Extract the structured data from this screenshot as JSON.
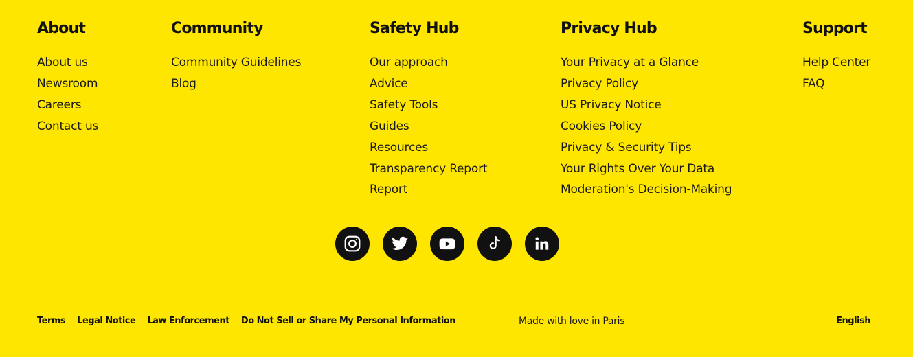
{
  "colors": {
    "background": "#FFE600",
    "text": "#1a1a1a",
    "icon_bg": "#111111",
    "icon_fg": "#FFFFFF"
  },
  "columns": {
    "about": {
      "title": "About",
      "links": [
        "About us",
        "Newsroom",
        "Careers",
        "Contact us"
      ]
    },
    "community": {
      "title": "Community",
      "links": [
        "Community Guidelines",
        "Blog"
      ]
    },
    "safety": {
      "title": "Safety Hub",
      "links": [
        "Our approach",
        "Advice",
        "Safety Tools",
        "Guides",
        "Resources",
        "Transparency Report",
        "Report"
      ]
    },
    "privacy": {
      "title": "Privacy Hub",
      "links": [
        "Your Privacy at a Glance",
        "Privacy Policy",
        "US Privacy Notice",
        "Cookies Policy",
        "Privacy & Security Tips",
        "Your Rights Over Your Data",
        "Moderation's Decision-Making"
      ]
    },
    "support": {
      "title": "Support",
      "links": [
        "Help Center",
        "FAQ"
      ]
    }
  },
  "social": [
    {
      "icon": "instagram-icon"
    },
    {
      "icon": "twitter-icon"
    },
    {
      "icon": "youtube-icon"
    },
    {
      "icon": "tiktok-icon"
    },
    {
      "icon": "linkedin-icon"
    }
  ],
  "bottom": {
    "legal_links": [
      "Terms",
      "Legal Notice",
      "Law Enforcement",
      "Do Not Sell or Share My Personal Information"
    ],
    "made_with": "Made with love in Paris",
    "language": "English"
  }
}
